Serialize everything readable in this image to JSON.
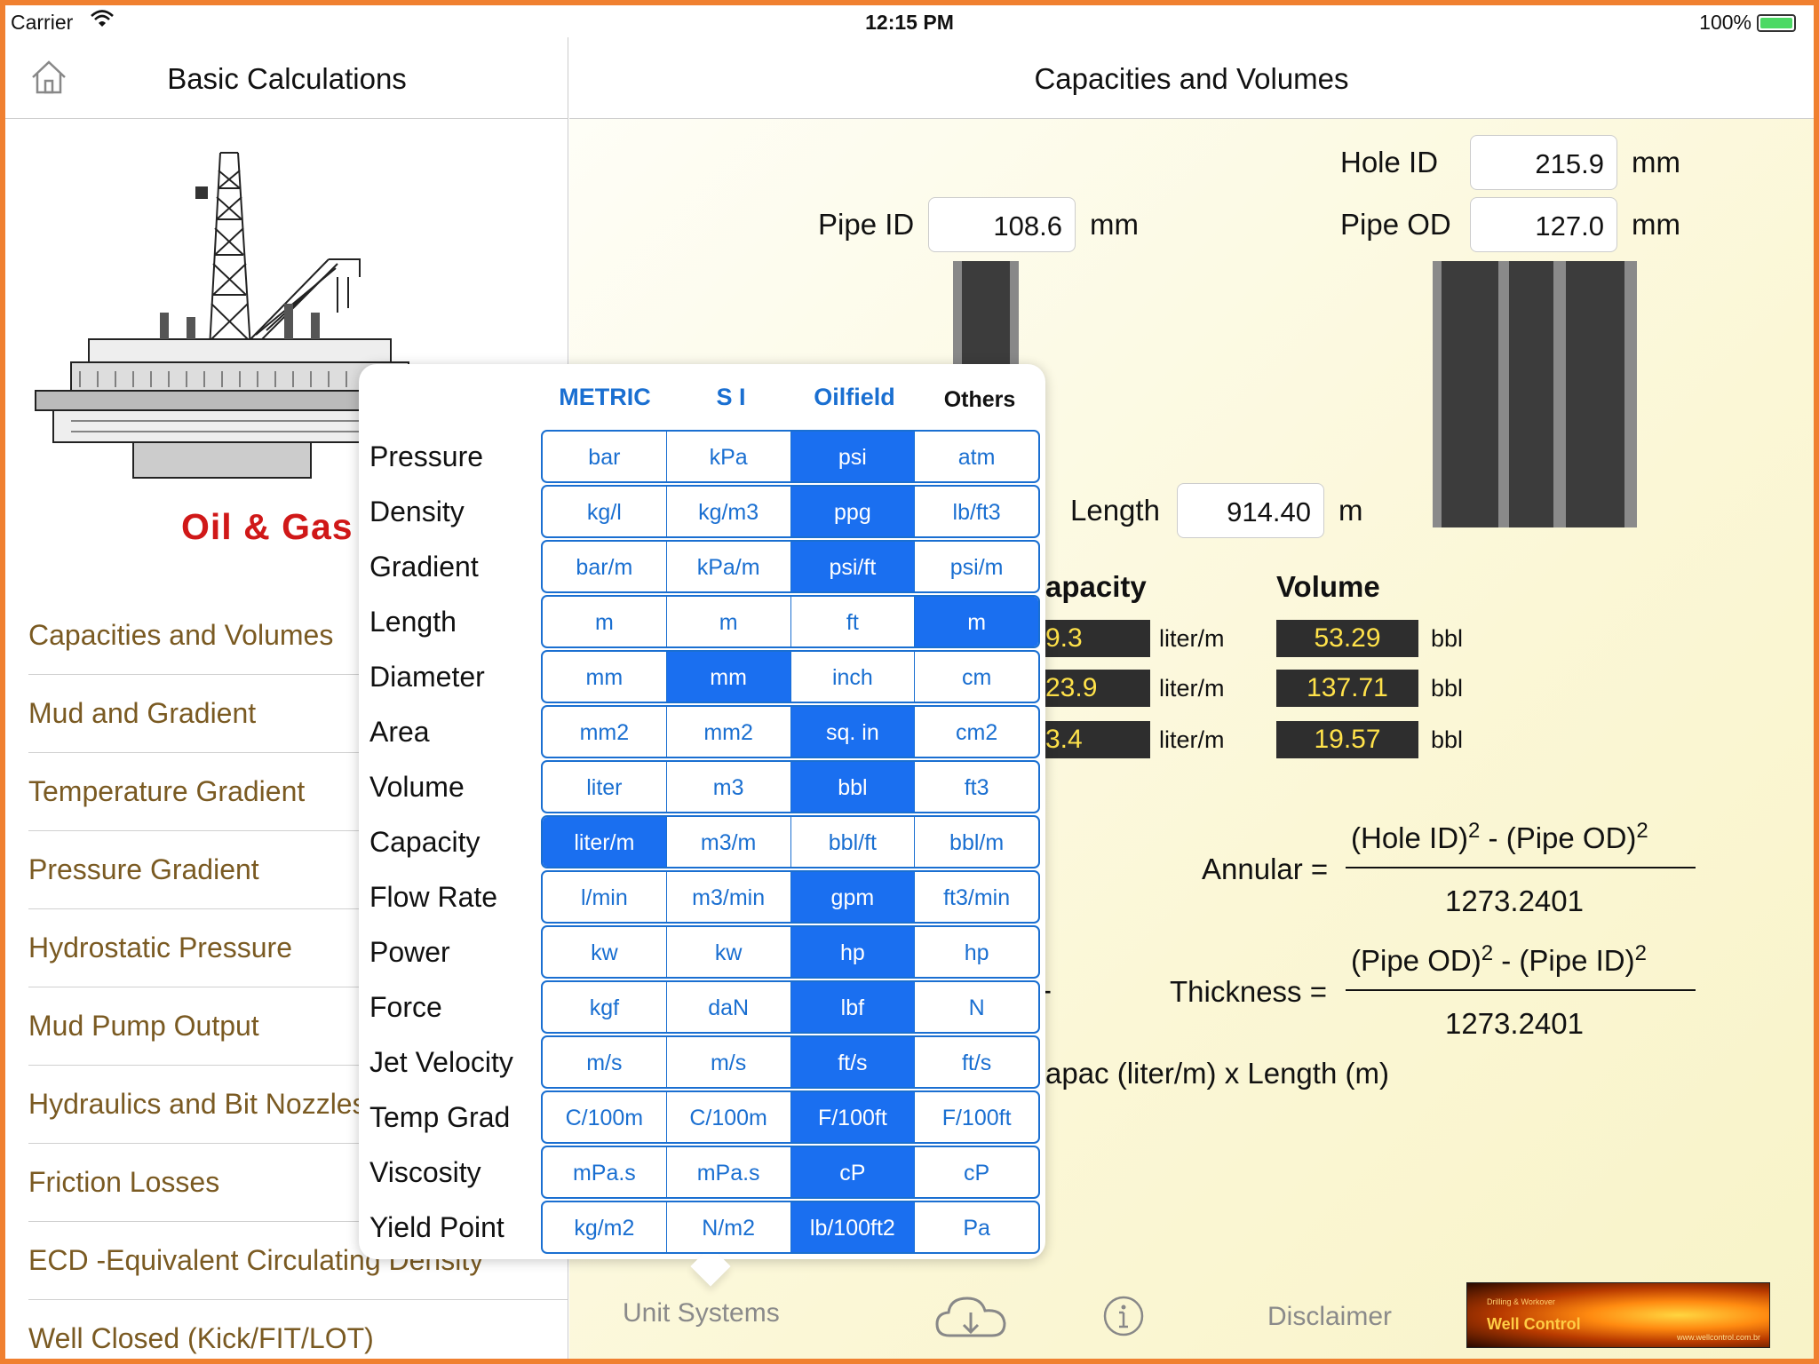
{
  "status": {
    "carrier": "Carrier",
    "time": "12:15 PM",
    "battery": "100%"
  },
  "left_nav": {
    "title": "Basic Calculations"
  },
  "brand": "Oil & Gas",
  "menu": [
    "Capacities and Volumes",
    "Mud and Gradient",
    "Temperature Gradient",
    "Pressure Gradient",
    "Hydrostatic Pressure",
    "Mud Pump Output",
    "Hydraulics and Bit Nozzles",
    "Friction Losses",
    "ECD -Equivalent Circulating Density",
    "Well Closed (Kick/FIT/LOT)"
  ],
  "main": {
    "title": "Capacities and Volumes",
    "hole_id": {
      "label": "Hole ID",
      "value": "215.9",
      "unit": "mm"
    },
    "pipe_id": {
      "label": "Pipe ID",
      "value": "108.6",
      "unit": "mm"
    },
    "pipe_od": {
      "label": "Pipe OD",
      "value": "127.0",
      "unit": "mm"
    },
    "length": {
      "label": "Length",
      "value": "914.40",
      "unit": "m"
    },
    "capacity_header": "apacity",
    "volume_header": "Volume",
    "results": [
      {
        "cap": "9.3",
        "cap_unit": "liter/m",
        "vol": "53.29",
        "vol_unit": "bbl"
      },
      {
        "cap": "23.9",
        "cap_unit": "liter/m",
        "vol": "137.71",
        "vol_unit": "bbl"
      },
      {
        "cap": "3.4",
        "cap_unit": "liter/m",
        "vol": "19.57",
        "vol_unit": "bbl"
      }
    ],
    "formula_annular": {
      "label": "Annular =",
      "num_a": "(Hole ID)",
      "sup_a": "2",
      "minus": " - ",
      "num_b": "(Pipe OD)",
      "sup_b": "2",
      "den": "1273.2401"
    },
    "formula_thickness": {
      "label": "Thickness =",
      "num_a": "(Pipe OD)",
      "sup_a": "2",
      "minus": " - ",
      "num_b": "(Pipe ID)",
      "sup_b": "2",
      "den": "1273.2401"
    },
    "dash": "-",
    "volume_formula": "apac (liter/m) x Length (m)"
  },
  "tabbar": {
    "unit_systems": "Unit Systems",
    "disclaimer": "Disclaimer",
    "logo_text": "Well Control",
    "logo_small": "Drilling & Workover",
    "logo_url": "www.wellcontrol.com.br"
  },
  "popover": {
    "columns": [
      "METRIC",
      "S I",
      "Oilfield",
      "Others"
    ],
    "rows": [
      {
        "label": "Pressure",
        "options": [
          "bar",
          "kPa",
          "psi",
          "atm"
        ],
        "selected": 2
      },
      {
        "label": "Density",
        "options": [
          "kg/l",
          "kg/m3",
          "ppg",
          "lb/ft3"
        ],
        "selected": 2
      },
      {
        "label": "Gradient",
        "options": [
          "bar/m",
          "kPa/m",
          "psi/ft",
          "psi/m"
        ],
        "selected": 2
      },
      {
        "label": "Length",
        "options": [
          "m",
          "m",
          "ft",
          "m"
        ],
        "selected": 3
      },
      {
        "label": "Diameter",
        "options": [
          "mm",
          "mm",
          "inch",
          "cm"
        ],
        "selected": 1
      },
      {
        "label": "Area",
        "options": [
          "mm2",
          "mm2",
          "sq. in",
          "cm2"
        ],
        "selected": 2
      },
      {
        "label": "Volume",
        "options": [
          "liter",
          "m3",
          "bbl",
          "ft3"
        ],
        "selected": 2
      },
      {
        "label": "Capacity",
        "options": [
          "liter/m",
          "m3/m",
          "bbl/ft",
          "bbl/m"
        ],
        "selected": 0
      },
      {
        "label": "Flow Rate",
        "options": [
          "l/min",
          "m3/min",
          "gpm",
          "ft3/min"
        ],
        "selected": 2
      },
      {
        "label": "Power",
        "options": [
          "kw",
          "kw",
          "hp",
          "hp"
        ],
        "selected": 2
      },
      {
        "label": "Force",
        "options": [
          "kgf",
          "daN",
          "lbf",
          "N"
        ],
        "selected": 2
      },
      {
        "label": "Jet Velocity",
        "options": [
          "m/s",
          "m/s",
          "ft/s",
          "ft/s"
        ],
        "selected": 2
      },
      {
        "label": "Temp Grad",
        "options": [
          "C/100m",
          "C/100m",
          "F/100ft",
          "F/100ft"
        ],
        "selected": 2
      },
      {
        "label": "Viscosity",
        "options": [
          "mPa.s",
          "mPa.s",
          "cP",
          "cP"
        ],
        "selected": 2
      },
      {
        "label": "Yield Point",
        "options": [
          "kg/m2",
          "N/m2",
          "lb/100ft2",
          "Pa"
        ],
        "selected": 2
      }
    ]
  },
  "colors": {
    "accent": "#1a6fd1",
    "selected": "#1a6ff0",
    "menu_text": "#7a5a22",
    "brand": "#d01818",
    "result_bg": "#2e2e2e",
    "result_text": "#ffe24a",
    "frame": "#f08030"
  },
  "icons": [
    "wifi-icon",
    "battery-icon",
    "home-icon",
    "cloud-download-icon",
    "info-icon"
  ]
}
